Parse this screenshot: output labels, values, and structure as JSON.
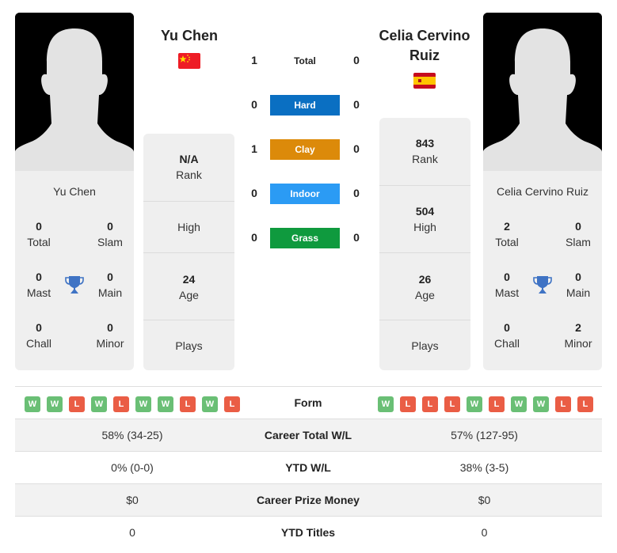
{
  "colors": {
    "hard": "#0a6fc2",
    "clay": "#dc8a0a",
    "indoor": "#2b9bf4",
    "grass": "#0f9a3e",
    "win": "#6abf75",
    "loss": "#ea5d45",
    "trophy": "#3f73c4"
  },
  "player1": {
    "name": "Yu Chen",
    "flag": "china-flag",
    "titles": {
      "total": {
        "value": "0",
        "label": "Total"
      },
      "slam": {
        "value": "0",
        "label": "Slam"
      },
      "mast": {
        "value": "0",
        "label": "Mast"
      },
      "main": {
        "value": "0",
        "label": "Main"
      },
      "chall": {
        "value": "0",
        "label": "Chall"
      },
      "minor": {
        "value": "0",
        "label": "Minor"
      }
    },
    "info": {
      "rank": {
        "value": "N/A",
        "label": "Rank"
      },
      "high": {
        "value": "",
        "label": "High"
      },
      "age": {
        "value": "24",
        "label": "Age"
      },
      "plays": {
        "value": "",
        "label": "Plays"
      }
    },
    "form": [
      "W",
      "W",
      "L",
      "W",
      "L",
      "W",
      "W",
      "L",
      "W",
      "L"
    ]
  },
  "player2": {
    "name": "Celia Cervino Ruiz",
    "flag": "spain-flag",
    "titles": {
      "total": {
        "value": "2",
        "label": "Total"
      },
      "slam": {
        "value": "0",
        "label": "Slam"
      },
      "mast": {
        "value": "0",
        "label": "Mast"
      },
      "main": {
        "value": "0",
        "label": "Main"
      },
      "chall": {
        "value": "0",
        "label": "Chall"
      },
      "minor": {
        "value": "2",
        "label": "Minor"
      }
    },
    "info": {
      "rank": {
        "value": "843",
        "label": "Rank"
      },
      "high": {
        "value": "504",
        "label": "High"
      },
      "age": {
        "value": "26",
        "label": "Age"
      },
      "plays": {
        "value": "",
        "label": "Plays"
      }
    },
    "form": [
      "W",
      "L",
      "L",
      "L",
      "W",
      "L",
      "W",
      "W",
      "L",
      "L"
    ]
  },
  "h2h": [
    {
      "label": "Total",
      "left": "1",
      "right": "0",
      "surface": "total"
    },
    {
      "label": "Hard",
      "left": "0",
      "right": "0",
      "surface": "hard"
    },
    {
      "label": "Clay",
      "left": "1",
      "right": "0",
      "surface": "clay"
    },
    {
      "label": "Indoor",
      "left": "0",
      "right": "0",
      "surface": "indoor"
    },
    {
      "label": "Grass",
      "left": "0",
      "right": "0",
      "surface": "grass"
    }
  ],
  "stats": {
    "form_label": "Form",
    "rows": [
      {
        "label": "Career Total W/L",
        "left": "58% (34-25)",
        "right": "57% (127-95)"
      },
      {
        "label": "YTD W/L",
        "left": "0% (0-0)",
        "right": "38% (3-5)"
      },
      {
        "label": "Career Prize Money",
        "left": "$0",
        "right": "$0"
      },
      {
        "label": "YTD Titles",
        "left": "0",
        "right": "0"
      }
    ]
  }
}
